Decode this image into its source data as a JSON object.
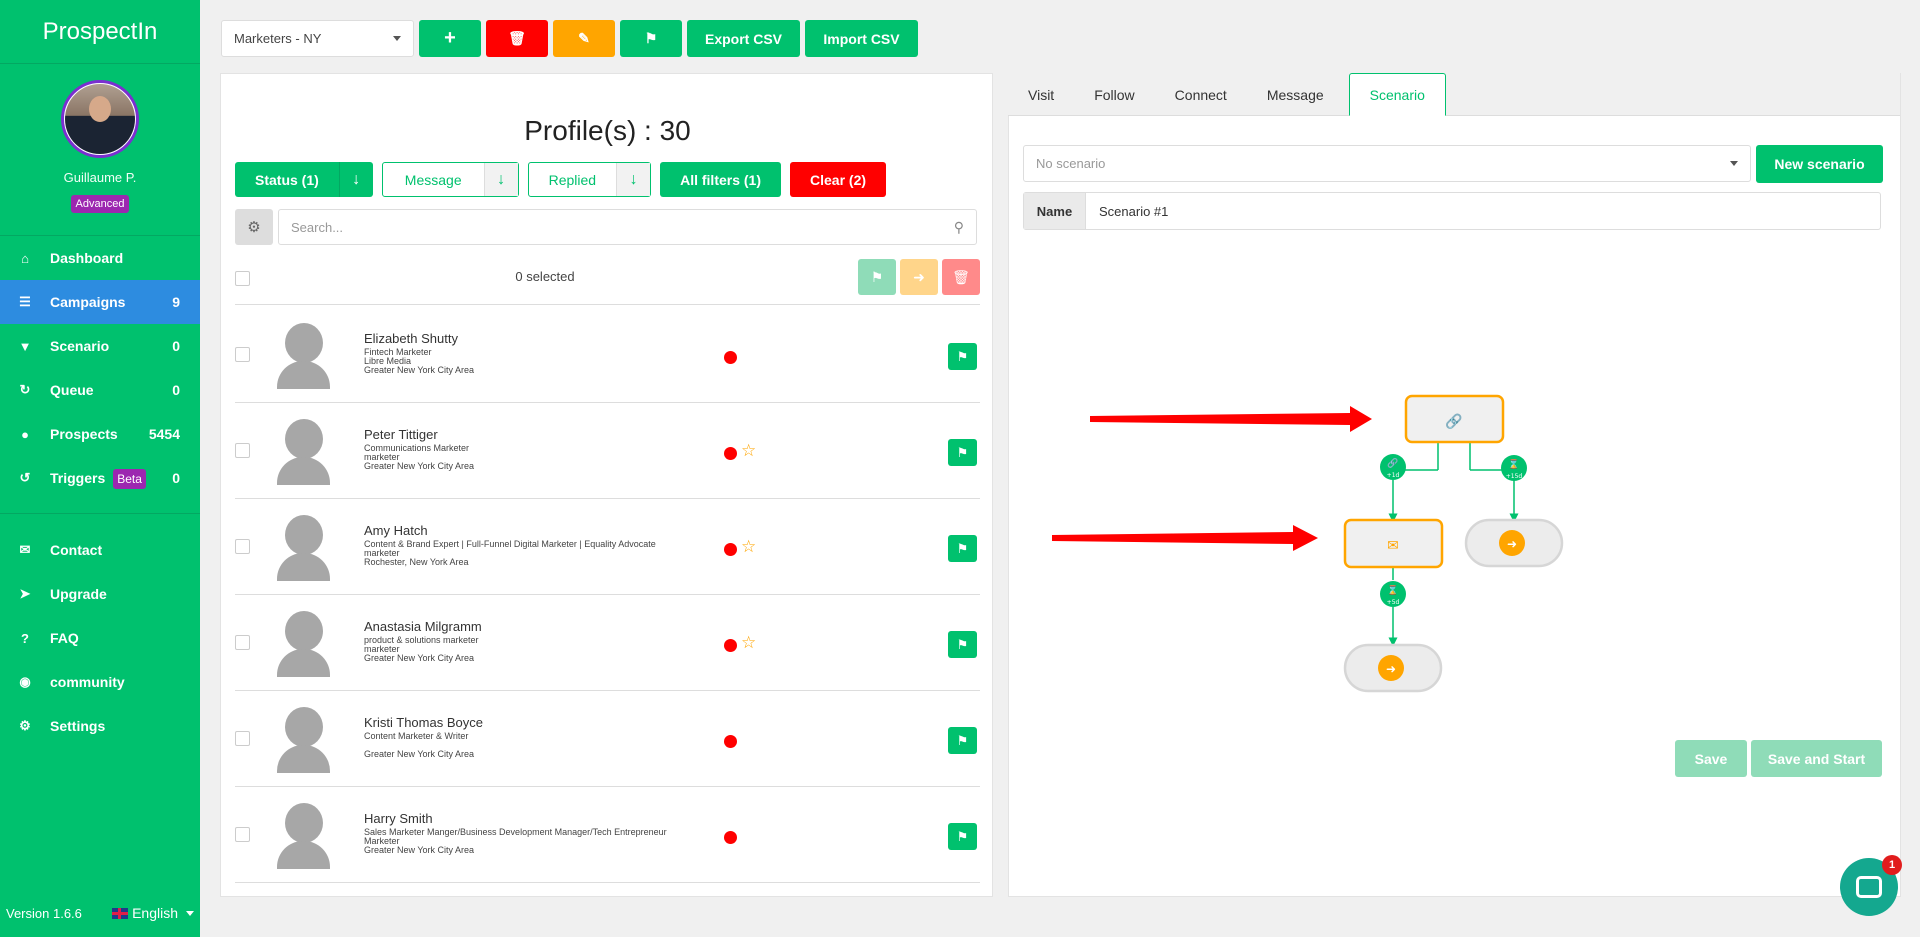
{
  "sidebar": {
    "brand": "ProspectIn",
    "user_name": "Guillaume P.",
    "plan": "Advanced",
    "nav": [
      {
        "label": "Dashboard",
        "count": "",
        "icon": "home-icon"
      },
      {
        "label": "Campaigns",
        "count": "9",
        "icon": "list-icon",
        "active": true
      },
      {
        "label": "Scenario",
        "count": "0",
        "icon": "filter-icon"
      },
      {
        "label": "Queue",
        "count": "0",
        "icon": "refresh-icon"
      },
      {
        "label": "Prospects",
        "count": "5454",
        "icon": "user-icon"
      },
      {
        "label": "Triggers",
        "badge": "Beta",
        "count": "0",
        "icon": "history-icon"
      }
    ],
    "nav2": [
      {
        "label": "Contact",
        "icon": "envelope-icon"
      },
      {
        "label": "Upgrade",
        "icon": "rocket-icon"
      },
      {
        "label": "FAQ",
        "icon": "question-icon"
      },
      {
        "label": "community",
        "icon": "community-icon"
      },
      {
        "label": "Settings",
        "icon": "gear-icon"
      }
    ],
    "version": "Version 1.6.6",
    "language": "English"
  },
  "toolbar": {
    "campaign_select": "Marketers - NY",
    "export_label": "Export CSV",
    "import_label": "Import CSV"
  },
  "list": {
    "title": "Profile(s) : 30",
    "filters": {
      "status": "Status (1)",
      "message": "Message",
      "replied": "Replied",
      "all_filters": "All filters (1)",
      "clear": "Clear (2)"
    },
    "search_placeholder": "Search...",
    "selected_text": "0 selected",
    "profiles": [
      {
        "name": "Elizabeth Shutty",
        "lines": [
          "Fintech Marketer",
          "Libre Media",
          "Greater New York City Area"
        ],
        "star": false
      },
      {
        "name": "Peter Tittiger",
        "lines": [
          "Communications Marketer",
          "marketer",
          "Greater New York City Area"
        ],
        "star": true
      },
      {
        "name": "Amy Hatch",
        "lines": [
          "Content & Brand Expert | Full-Funnel Digital Marketer | Equality Advocate",
          "marketer",
          "Rochester, New York Area"
        ],
        "star": true
      },
      {
        "name": "Anastasia Milgramm",
        "lines": [
          "product & solutions marketer",
          "marketer",
          "Greater New York City Area"
        ],
        "star": true
      },
      {
        "name": "Kristi Thomas Boyce",
        "lines": [
          "Content Marketer & Writer",
          "",
          "Greater New York City Area"
        ],
        "star": false
      },
      {
        "name": "Harry Smith",
        "lines": [
          "Sales Marketer Manger/Business Development Manager/Tech Entrepreneur",
          "Marketer",
          "Greater New York City Area"
        ],
        "star": false
      }
    ]
  },
  "scenario": {
    "tabs": [
      "Visit",
      "Follow",
      "Connect",
      "Message",
      "Scenario"
    ],
    "active_tab": "Scenario",
    "select_placeholder": "No scenario",
    "new_label": "New scenario",
    "name_label": "Name",
    "name_value": "Scenario #1",
    "flow": {
      "delays": [
        "+1d",
        "+15d",
        "+5d"
      ]
    },
    "save_label": "Save",
    "save_start_label": "Save and Start"
  },
  "chat": {
    "badge": "1"
  },
  "colors": {
    "brand_green": "#00c16e",
    "active_blue": "#2d8ce0",
    "danger_red": "#ff0000",
    "warning_orange": "#ffa500",
    "beta_purple": "#9c27b0"
  }
}
